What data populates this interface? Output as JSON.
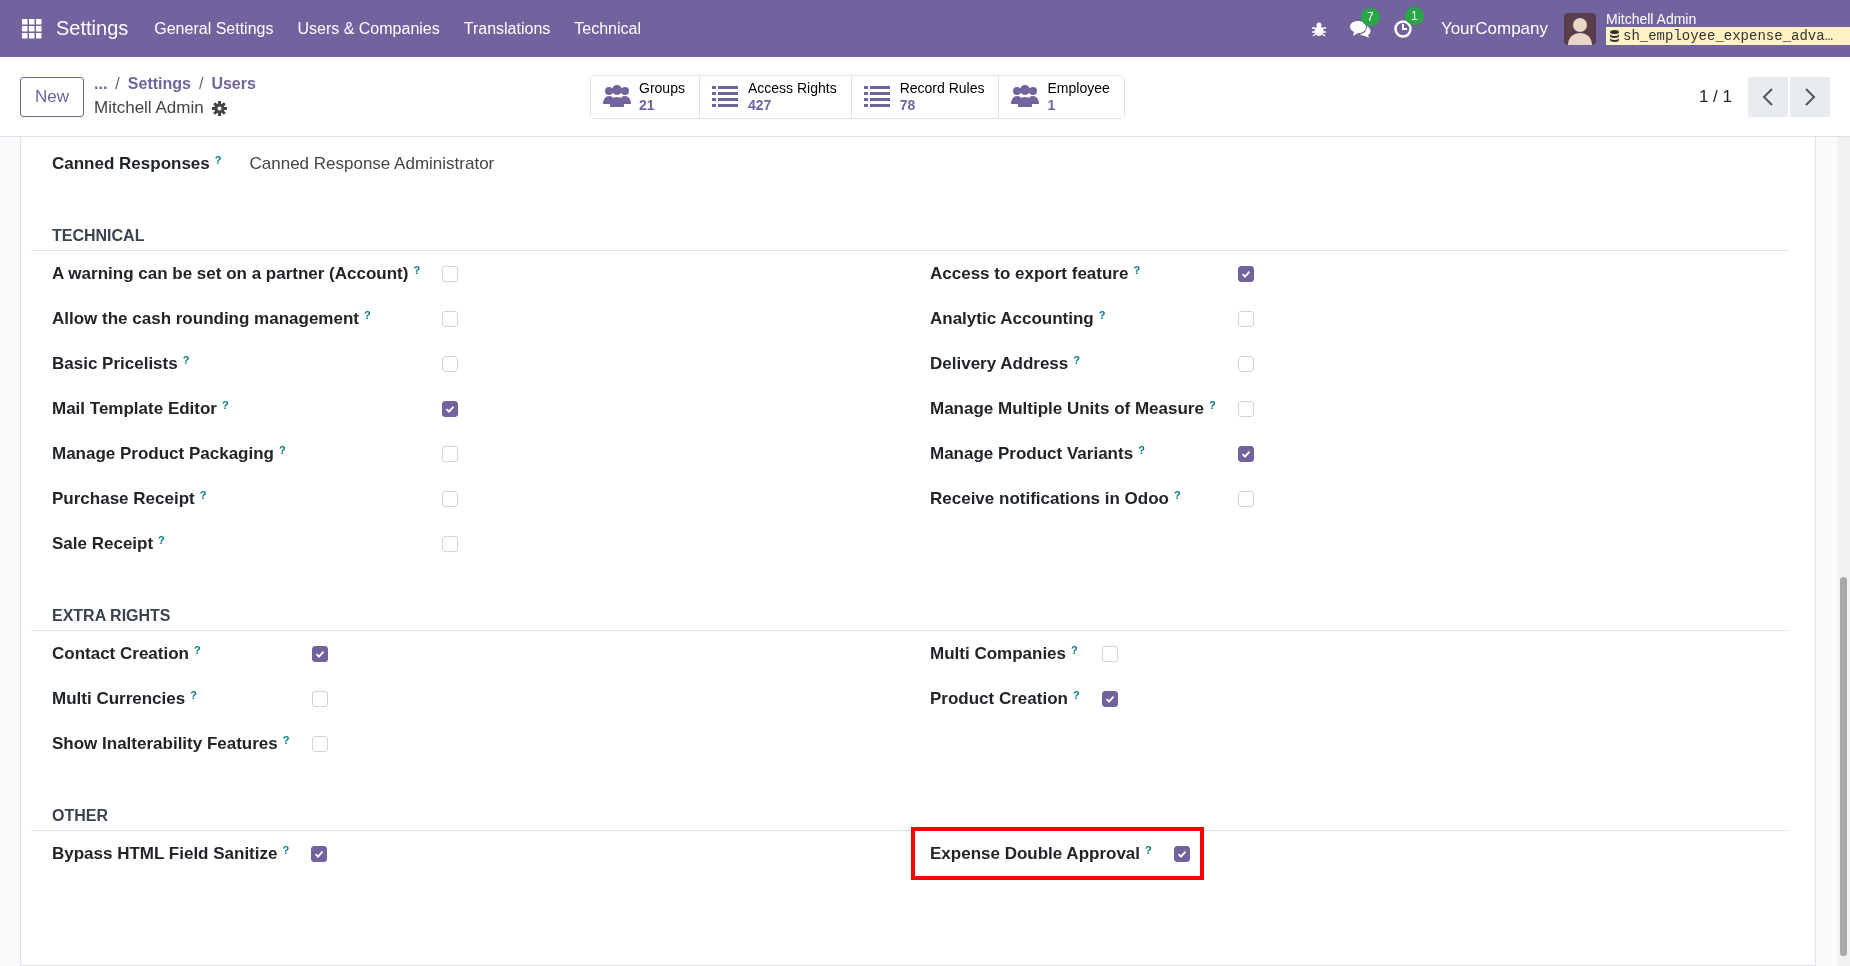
{
  "navbar": {
    "app_name": "Settings",
    "menu": [
      "General Settings",
      "Users & Companies",
      "Translations",
      "Technical"
    ],
    "messages_count": "7",
    "activities_count": "1",
    "company": "YourCompany",
    "user_name": "Mitchell Admin",
    "database": "sh_employee_expense_adva…"
  },
  "control_panel": {
    "new_button": "New",
    "breadcrumbs": [
      {
        "text": "..."
      },
      {
        "separator": "/",
        "text": "Settings"
      },
      {
        "separator": "/",
        "text": "Users"
      }
    ],
    "record_name": "Mitchell Admin",
    "smart_buttons": [
      {
        "kind": "users",
        "label": "Groups",
        "count": "21"
      },
      {
        "kind": "list",
        "label": "Access Rights",
        "count": "427"
      },
      {
        "kind": "list",
        "label": "Record Rules",
        "count": "78"
      },
      {
        "kind": "users",
        "label": "Employee",
        "count": "1"
      }
    ],
    "pager": "1 / 1"
  },
  "canned_responses": {
    "label": "Canned Responses",
    "help": "?",
    "value": "Canned Response Administrator"
  },
  "sections": [
    {
      "title": "TECHNICAL",
      "columns": [
        [
          {
            "label": "A warning can be set on a partner (Account)",
            "help": "?",
            "checked": false,
            "highlighted": false
          },
          {
            "label": "Allow the cash rounding management",
            "help": "?",
            "checked": false,
            "highlighted": false
          },
          {
            "label": "Basic Pricelists",
            "help": "?",
            "checked": false,
            "highlighted": false
          },
          {
            "label": "Mail Template Editor",
            "help": "?",
            "checked": true,
            "highlighted": false
          },
          {
            "label": "Manage Product Packaging",
            "help": "?",
            "checked": false,
            "highlighted": false
          },
          {
            "label": "Purchase Receipt",
            "help": "?",
            "checked": false,
            "highlighted": false
          },
          {
            "label": "Sale Receipt",
            "help": "?",
            "checked": false,
            "highlighted": false
          }
        ],
        [
          {
            "label": "Access to export feature",
            "help": "?",
            "checked": true,
            "highlighted": false
          },
          {
            "label": "Analytic Accounting",
            "help": "?",
            "checked": false,
            "highlighted": false
          },
          {
            "label": "Delivery Address",
            "help": "?",
            "checked": false,
            "highlighted": false
          },
          {
            "label": "Manage Multiple Units of Measure",
            "help": "?",
            "checked": false,
            "highlighted": false
          },
          {
            "label": "Manage Product Variants",
            "help": "?",
            "checked": true,
            "highlighted": false
          },
          {
            "label": "Receive notifications in Odoo",
            "help": "?",
            "checked": false,
            "highlighted": false
          }
        ]
      ]
    },
    {
      "title": "EXTRA RIGHTS",
      "columns": [
        [
          {
            "label": "Contact Creation",
            "help": "?",
            "checked": true,
            "highlighted": false
          },
          {
            "label": "Multi Currencies",
            "help": "?",
            "checked": false,
            "highlighted": false
          },
          {
            "label": "Show Inalterability Features",
            "help": "?",
            "checked": false,
            "highlighted": false
          }
        ],
        [
          {
            "label": "Multi Companies",
            "help": "?",
            "checked": false,
            "highlighted": false
          },
          {
            "label": "Product Creation",
            "help": "?",
            "checked": true,
            "highlighted": false
          }
        ]
      ]
    },
    {
      "title": "OTHER",
      "columns": [
        [
          {
            "label": "Bypass HTML Field Sanitize",
            "help": "?",
            "checked": true,
            "highlighted": false
          }
        ],
        [
          {
            "label": "Expense Double Approval",
            "help": "?",
            "checked": true,
            "highlighted": true
          }
        ]
      ]
    }
  ]
}
